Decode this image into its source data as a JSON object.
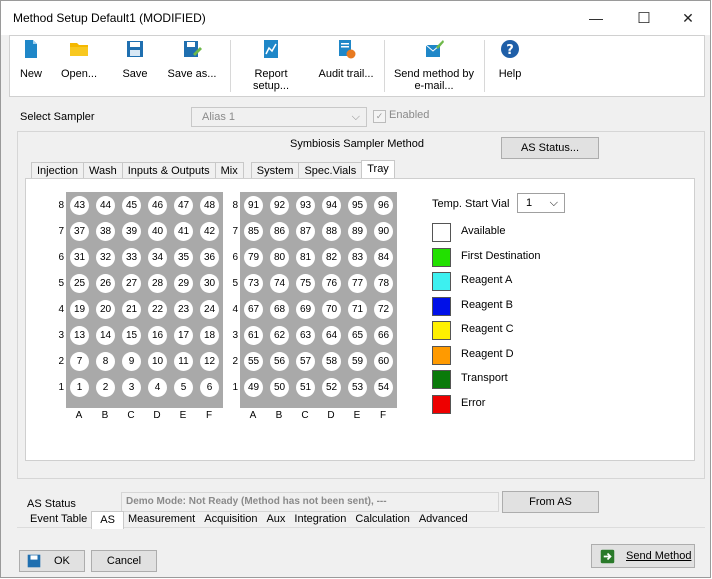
{
  "window": {
    "title": "Method Setup Default1 (MODIFIED)",
    "controls": {
      "minimize": "—",
      "maximize": "☐",
      "close": "✕"
    }
  },
  "toolbar": {
    "new": "New",
    "open": "Open...",
    "save": "Save",
    "save_as": "Save as...",
    "report_setup": "Report setup...",
    "audit_trail": "Audit trail...",
    "send_email_1": "Send method by",
    "send_email_2": "e-mail...",
    "help": "Help",
    "icon_colors": {
      "primary": "#1f87c8",
      "folder": "#f5b800",
      "help": "#1f5fa8"
    }
  },
  "sampler": {
    "label": "Select Sampler",
    "value": "Alias 1",
    "enabled_label": "Enabled",
    "enabled_checked": true
  },
  "method": {
    "title": "Symbiosis Sampler Method",
    "as_status_button": "AS Status...",
    "tabs": [
      "Injection",
      "Wash",
      "Inputs & Outputs",
      "Mix",
      "System",
      "Spec.Vials",
      "Tray"
    ],
    "active_tab": "Tray"
  },
  "tray": {
    "temp_start_label": "Temp. Start Vial",
    "temp_start_value": "1",
    "row_labels": [
      "8",
      "7",
      "6",
      "5",
      "4",
      "3",
      "2",
      "1"
    ],
    "col_labels": [
      "A",
      "B",
      "C",
      "D",
      "E",
      "F"
    ],
    "left_rows": [
      [
        "43",
        "44",
        "45",
        "46",
        "47",
        "48"
      ],
      [
        "37",
        "38",
        "39",
        "40",
        "41",
        "42"
      ],
      [
        "31",
        "32",
        "33",
        "34",
        "35",
        "36"
      ],
      [
        "25",
        "26",
        "27",
        "28",
        "29",
        "30"
      ],
      [
        "19",
        "20",
        "21",
        "22",
        "23",
        "24"
      ],
      [
        "13",
        "14",
        "15",
        "16",
        "17",
        "18"
      ],
      [
        "7",
        "8",
        "9",
        "10",
        "11",
        "12"
      ],
      [
        "1",
        "2",
        "3",
        "4",
        "5",
        "6"
      ]
    ],
    "right_rows": [
      [
        "91",
        "92",
        "93",
        "94",
        "95",
        "96"
      ],
      [
        "85",
        "86",
        "87",
        "88",
        "89",
        "90"
      ],
      [
        "79",
        "80",
        "81",
        "82",
        "83",
        "84"
      ],
      [
        "73",
        "74",
        "75",
        "76",
        "77",
        "78"
      ],
      [
        "67",
        "68",
        "69",
        "70",
        "71",
        "72"
      ],
      [
        "61",
        "62",
        "63",
        "64",
        "65",
        "66"
      ],
      [
        "55",
        "56",
        "57",
        "58",
        "59",
        "60"
      ],
      [
        "49",
        "50",
        "51",
        "52",
        "53",
        "54"
      ]
    ],
    "legend": [
      {
        "label": "Available",
        "color": "#ffffff"
      },
      {
        "label": "First Destination",
        "color": "#22e000"
      },
      {
        "label": "Reagent A",
        "color": "#3df0f0"
      },
      {
        "label": "Reagent B",
        "color": "#0010e8"
      },
      {
        "label": "Reagent C",
        "color": "#fff000"
      },
      {
        "label": "Reagent D",
        "color": "#ff9a00"
      },
      {
        "label": "Transport",
        "color": "#0a7a0a"
      },
      {
        "label": "Error",
        "color": "#ee0000"
      }
    ]
  },
  "as_status": {
    "label": "AS Status",
    "value": "Demo Mode: Not Ready (Method has not been sent), ---",
    "from_as_button": "From AS"
  },
  "bottom_tabs": {
    "items": [
      "Event Table",
      "AS",
      "Measurement",
      "Acquisition",
      "Aux",
      "Integration",
      "Calculation",
      "Advanced"
    ],
    "active": "AS"
  },
  "footer": {
    "ok": "OK",
    "cancel": "Cancel",
    "send_method": "Send Method"
  }
}
